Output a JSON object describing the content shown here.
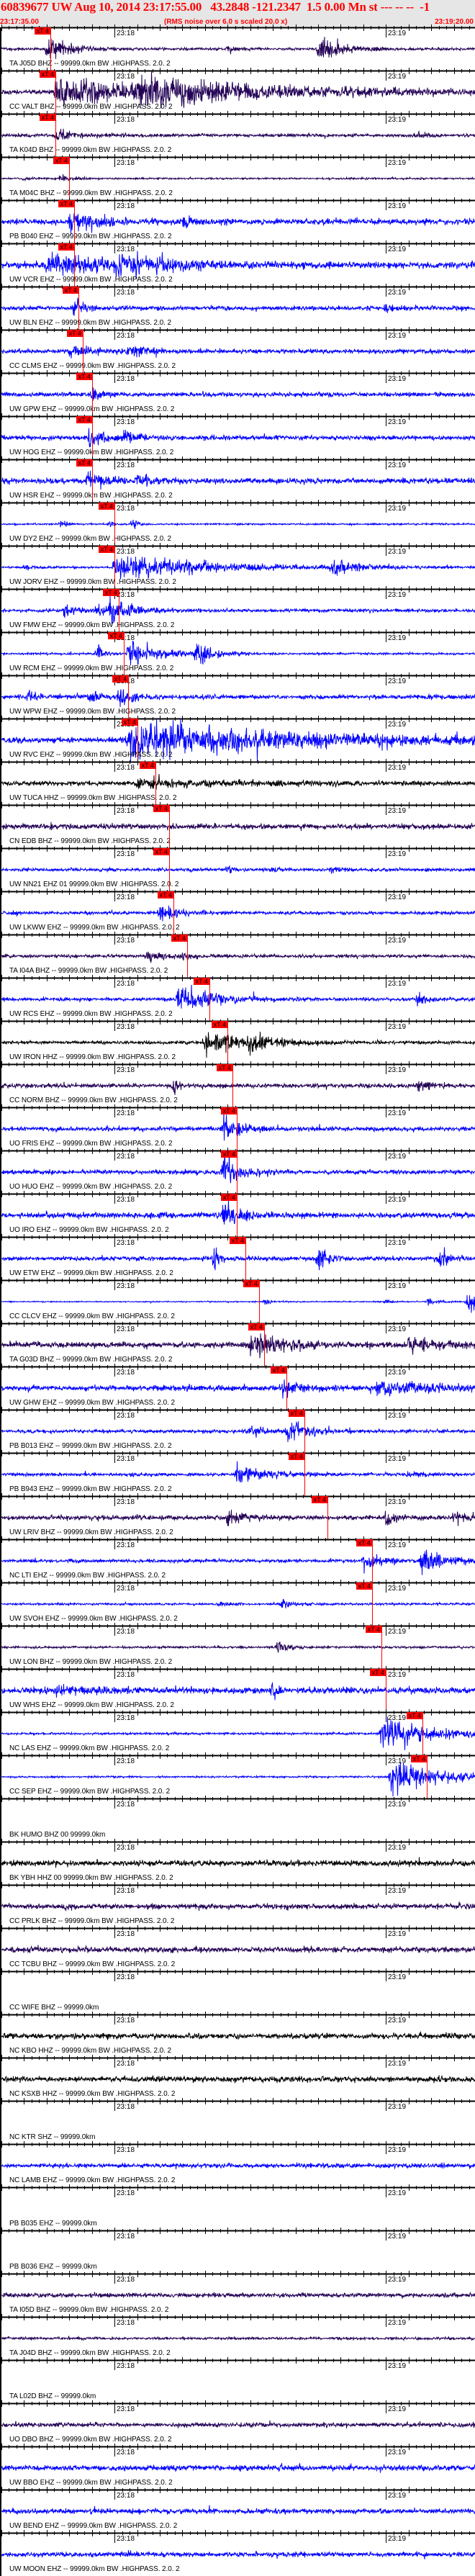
{
  "header": {
    "title": "60839677 UW Aug 10, 2014 23:17:55.00   43.2848 -121.2347  1.5 0.00 Mn st --- -- --  -1",
    "start_time": "23:17:35.00",
    "note": "(RMS noise over 6.0 s scaled 20.0 x)",
    "end_time": "23:19:20.00"
  },
  "colors": {
    "navy": "#220055",
    "blue": "#0000ff",
    "black": "#000000",
    "pick": "#ff0000",
    "header_text": "#ff0000"
  },
  "chart_data": {
    "type": "line",
    "title": "60839677 UW Aug 10, 2014 23:17:55.00",
    "x_range_seconds": [
      0,
      105
    ],
    "x_origin": "23:17:35.00",
    "tick_labels": [
      {
        "t": 25,
        "label": "23:18"
      },
      {
        "t": 85,
        "label": "23:19"
      }
    ],
    "pick_label": "xT 4",
    "traces": [
      {
        "label": "TA J05D BHZ -- 99999.0km BW .HIGHPASS. 2.0. 2",
        "color": "navy",
        "noise": 0.12,
        "pick": 10.8,
        "events": [
          [
            10,
            1.2,
            4
          ],
          [
            70,
            1.0,
            5
          ],
          [
            50,
            0.3,
            2
          ]
        ]
      },
      {
        "label": "CC VALT BHZ -- 99999.0km BW .HIGHPASS. 2.0. 2",
        "color": "navy",
        "noise": 0.2,
        "pick": 11.9,
        "events": [
          [
            12,
            0.9,
            30
          ],
          [
            30,
            0.8,
            25
          ]
        ]
      },
      {
        "label": "TA K04D BHZ -- 99999.0km BW .HIGHPASS. 2.0. 2",
        "color": "navy",
        "noise": 0.15,
        "pick": 11.9,
        "events": [
          [
            12,
            0.4,
            5
          ],
          [
            92,
            0.35,
            2
          ]
        ]
      },
      {
        "label": "TA M04C BHZ -- 99999.0km BW .HIGHPASS. 2.0. 2",
        "color": "navy",
        "noise": 0.08,
        "pick": 15.0,
        "events": [
          [
            13,
            0.35,
            2
          ],
          [
            5,
            0.2,
            1
          ]
        ]
      },
      {
        "label": "PB B040 EHZ -- 99999.0km BW .HIGHPASS. 2.0. 2",
        "color": "blue",
        "noise": 0.25,
        "pick": 16.1,
        "events": [
          [
            15,
            0.8,
            6
          ],
          [
            40,
            0.35,
            4
          ]
        ]
      },
      {
        "label": "UW VCR EHZ -- 99999.0km BW .HIGHPASS. 2.0. 2",
        "color": "blue",
        "noise": 0.3,
        "pick": 16.1,
        "events": [
          [
            10,
            0.7,
            15
          ],
          [
            25,
            0.5,
            10
          ]
        ]
      },
      {
        "label": "UW BLN EHZ -- 99999.0km BW .HIGHPASS. 2.0. 2",
        "color": "blue",
        "noise": 0.2,
        "pick": 17.0,
        "events": [
          [
            16,
            0.8,
            2
          ],
          [
            85,
            0.6,
            1
          ]
        ]
      },
      {
        "label": "CC CLMS EHZ -- 99999.0km BW .HIGHPASS. 2.0. 2",
        "color": "blue",
        "noise": 0.2,
        "pick": 18.0,
        "events": [
          [
            15,
            0.4,
            5
          ],
          [
            28,
            0.4,
            4
          ]
        ]
      },
      {
        "label": "UW GPW EHZ -- 99999.0km BW .HIGHPASS. 2.0. 2",
        "color": "blue",
        "noise": 0.2,
        "pick": 20.0,
        "events": [
          [
            20,
            0.7,
            2
          ]
        ]
      },
      {
        "label": "UW HOG EHZ -- 99999.0km BW .HIGHPASS. 2.0. 2",
        "color": "blue",
        "noise": 0.2,
        "pick": 20.0,
        "events": [
          [
            19,
            0.6,
            4
          ],
          [
            27,
            0.4,
            3
          ]
        ]
      },
      {
        "label": "UW HSR EHZ -- 99999.0km BW .HIGHPASS. 2.0. 2",
        "color": "blue",
        "noise": 0.25,
        "pick": 20.0,
        "events": [
          [
            19,
            0.6,
            4
          ],
          [
            30,
            0.4,
            3
          ]
        ]
      },
      {
        "label": "UW DY2 EHZ -- 99999.0km BW .HIGHPASS. 2.0. 2",
        "color": "blue",
        "noise": 0.08,
        "pick": 25.0,
        "events": [
          [
            13,
            0.5,
            1
          ],
          [
            29,
            0.5,
            1
          ],
          [
            24,
            0.3,
            1
          ]
        ]
      },
      {
        "label": "UW JORV EHZ -- 99999.0km BW .HIGHPASS. 2.0. 2",
        "color": "blue",
        "noise": 0.08,
        "pick": 25.0,
        "events": [
          [
            25,
            1.0,
            20
          ],
          [
            5,
            0.2,
            3
          ],
          [
            73,
            0.5,
            6
          ]
        ]
      },
      {
        "label": "UW FMW EHZ -- 99999.0km BW .HIGHPASS. 2.0. 2",
        "color": "blue",
        "noise": 0.15,
        "pick": 26.0,
        "events": [
          [
            14,
            0.6,
            2
          ],
          [
            21,
            0.5,
            2
          ],
          [
            24,
            1.0,
            4
          ]
        ]
      },
      {
        "label": "UW RCM EHZ -- 99999.0km BW .HIGHPASS. 2.0. 2",
        "color": "blue",
        "noise": 0.1,
        "pick": 27.0,
        "events": [
          [
            21,
            1.0,
            1
          ],
          [
            28,
            1.0,
            6
          ],
          [
            43,
            1.0,
            3
          ]
        ]
      },
      {
        "label": "UW WPW EHZ -- 99999.0km BW .HIGHPASS. 2.0. 2",
        "color": "blue",
        "noise": 0.2,
        "pick": 28.0,
        "events": [
          [
            6,
            0.4,
            2
          ],
          [
            19,
            0.4,
            3
          ],
          [
            26,
            0.6,
            3
          ]
        ]
      },
      {
        "label": "UW RVC EHZ -- 99999.0km BW .HIGHPASS. 2.0. 2",
        "color": "blue",
        "noise": 0.25,
        "pick": 30.0,
        "events": [
          [
            28,
            1.2,
            40
          ]
        ]
      },
      {
        "label": "UW TUCA HHZ -- 99999.0km BW .HIGHPASS. 2.0. 2",
        "color": "black",
        "noise": 0.2,
        "pick": 34.0,
        "events": [
          [
            30,
            0.3,
            20
          ]
        ]
      },
      {
        "label": "CN EDB BHZ -- 99999.0km BW .HIGHPASS. 2.0. 2",
        "color": "navy",
        "noise": 0.25,
        "pick": 37.0,
        "events": []
      },
      {
        "label": "UW NN21 EHZ 01 99999.0km BW .HIGHPASS. 2.0. 2",
        "color": "blue",
        "noise": 0.15,
        "pick": 37.0,
        "events": [
          [
            50,
            0.3,
            1
          ],
          [
            60,
            0.3,
            1
          ],
          [
            73,
            0.3,
            2
          ]
        ]
      },
      {
        "label": "UW LKWW EHZ -- 99999.0km BW .HIGHPASS. 2.0. 2",
        "color": "blue",
        "noise": 0.15,
        "pick": 38.0,
        "events": [
          [
            35,
            0.8,
            3
          ]
        ]
      },
      {
        "label": "TA I04A BHZ -- 99999.0km BW .HIGHPASS. 2.0. 2",
        "color": "navy",
        "noise": 0.15,
        "pick": 41.0,
        "events": [
          [
            32,
            0.6,
            3
          ],
          [
            40,
            0.4,
            2
          ]
        ]
      },
      {
        "label": "UW RCS EHZ -- 99999.0km BW .HIGHPASS. 2.0. 2",
        "color": "blue",
        "noise": 0.15,
        "pick": 46.0,
        "events": [
          [
            39,
            1.0,
            8
          ],
          [
            92,
            0.5,
            2
          ]
        ]
      },
      {
        "label": "UW IRON HHZ -- 99999.0km BW .HIGHPASS. 2.0. 2",
        "color": "black",
        "noise": 0.15,
        "pick": 50.0,
        "events": [
          [
            45,
            0.9,
            8
          ],
          [
            55,
            0.6,
            5
          ]
        ]
      },
      {
        "label": "CC NORM BHZ -- 99999.0km BW .HIGHPASS. 2.0. 2",
        "color": "navy",
        "noise": 0.2,
        "pick": 51.0,
        "events": [
          [
            38,
            0.8,
            1
          ],
          [
            92,
            0.4,
            2
          ]
        ]
      },
      {
        "label": "UO FRIS EHZ -- 99999.0km BW .HIGHPASS. 2.0. 2",
        "color": "blue",
        "noise": 0.2,
        "pick": 52.0,
        "events": [
          [
            49,
            1.2,
            3
          ]
        ]
      },
      {
        "label": "UO HUO EHZ -- 99999.0km BW .HIGHPASS. 2.0. 2",
        "color": "blue",
        "noise": 0.2,
        "pick": 52.0,
        "events": [
          [
            49,
            1.2,
            3
          ]
        ]
      },
      {
        "label": "UO IRO EHZ -- 99999.0km BW .HIGHPASS. 2.0. 2",
        "color": "blue",
        "noise": 0.25,
        "pick": 52.0,
        "events": [
          [
            49,
            1.2,
            3
          ]
        ]
      },
      {
        "label": "UW ETW EHZ -- 99999.0km BW .HIGHPASS. 2.0. 2",
        "color": "blue",
        "noise": 0.2,
        "pick": 54.0,
        "events": [
          [
            47,
            1.0,
            1
          ],
          [
            70,
            1.2,
            2
          ],
          [
            97,
            1.2,
            1
          ]
        ]
      },
      {
        "label": "CC CLCV EHZ -- 99999.0km BW .HIGHPASS. 2.0. 2",
        "color": "blue",
        "noise": 0.05,
        "pick": 57.0,
        "events": [
          [
            58,
            0.2,
            2
          ],
          [
            85,
            0.2,
            1
          ],
          [
            94,
            0.3,
            2
          ],
          [
            103,
            1.0,
            3
          ]
        ]
      },
      {
        "label": "TA G03D BHZ -- 99999.0km BW .HIGHPASS. 2.0. 2",
        "color": "navy",
        "noise": 0.25,
        "pick": 58.0,
        "events": [
          [
            55,
            0.9,
            8
          ],
          [
            90,
            0.4,
            10
          ]
        ]
      },
      {
        "label": "UW GHW EHZ -- 99999.0km BW .HIGHPASS. 2.0. 2",
        "color": "blue",
        "noise": 0.25,
        "pick": 63.0,
        "events": [
          [
            62,
            0.5,
            4
          ],
          [
            83,
            0.6,
            10
          ]
        ]
      },
      {
        "label": "PB B013 EHZ -- 99999.0km BW .HIGHPASS. 2.0. 2",
        "color": "blue",
        "noise": 0.15,
        "pick": 67.0,
        "events": [
          [
            55,
            0.4,
            3
          ],
          [
            63,
            0.9,
            4
          ]
        ]
      },
      {
        "label": "PB B943 EHZ -- 99999.0km BW .HIGHPASS. 2.0. 2",
        "color": "blue",
        "noise": 0.15,
        "pick": 67.0,
        "events": [
          [
            52,
            0.7,
            6
          ],
          [
            90,
            0.2,
            3
          ]
        ]
      },
      {
        "label": "UW LRIV BHZ -- 99999.0km BW .HIGHPASS. 2.0. 2",
        "color": "navy",
        "noise": 0.2,
        "pick": 72.0,
        "events": [
          [
            50,
            0.6,
            3
          ],
          [
            85,
            0.7,
            2
          ],
          [
            100,
            0.7,
            2
          ]
        ]
      },
      {
        "label": "NC LTI EHZ -- 99999.0km BW .HIGHPASS. 2.0. 2",
        "color": "blue",
        "noise": 0.15,
        "pick": 82.0,
        "events": [
          [
            80,
            0.5,
            5
          ],
          [
            93,
            0.9,
            5
          ]
        ]
      },
      {
        "label": "UW SVOH EHZ -- 99999.0km BW .HIGHPASS. 2.0. 2",
        "color": "blue",
        "noise": 0.1,
        "pick": 82.0,
        "events": [
          [
            48,
            0.2,
            2
          ],
          [
            62,
            0.4,
            2
          ]
        ]
      },
      {
        "label": "UW LON BHZ -- 99999.0km BW .HIGHPASS. 2.0. 2",
        "color": "navy",
        "noise": 0.1,
        "pick": 84.0,
        "events": [
          [
            61,
            0.6,
            2
          ]
        ]
      },
      {
        "label": "UW WHS EHZ -- 99999.0km BW .HIGHPASS. 2.0. 2",
        "color": "blue",
        "noise": 0.3,
        "pick": 85.0,
        "events": [
          [
            12,
            0.3,
            6
          ],
          [
            60,
            0.7,
            1
          ]
        ]
      },
      {
        "label": "NC LAS EHZ -- 99999.0km BW .HIGHPASS. 2.0. 2",
        "color": "blue",
        "noise": 0.1,
        "pick": 93.0,
        "events": [
          [
            84,
            1.2,
            10
          ]
        ]
      },
      {
        "label": "CC SEP EHZ -- 99999.0km BW .HIGHPASS. 2.0. 2",
        "color": "blue",
        "noise": 0.08,
        "pick": 94.0,
        "events": [
          [
            86,
            1.3,
            10
          ]
        ]
      },
      {
        "label": "BK HUMO BHZ 00 99999.0km",
        "color": "navy",
        "noise": 0,
        "pick": null,
        "events": []
      },
      {
        "label": "BK YBH HHZ 00 99999.0km BW .HIGHPASS. 2.0. 2",
        "color": "black",
        "noise": 0.25,
        "pick": null,
        "events": []
      },
      {
        "label": "CC PRLK BHZ -- 99999.0km BW .HIGHPASS. 2.0. 2",
        "color": "navy",
        "noise": 0.25,
        "pick": null,
        "events": []
      },
      {
        "label": "CC TCBU BHZ -- 99999.0km BW .HIGHPASS. 2.0. 2",
        "color": "navy",
        "noise": 0.25,
        "pick": null,
        "events": []
      },
      {
        "label": "CC WIFE BHZ -- 99999.0km",
        "color": "black",
        "noise": 0,
        "pick": null,
        "events": []
      },
      {
        "label": "NC KBO HHZ -- 99999.0km BW .HIGHPASS. 2.0. 2",
        "color": "black",
        "noise": 0.25,
        "pick": null,
        "events": []
      },
      {
        "label": "NC KSXB HHZ -- 99999.0km BW .HIGHPASS. 2.0. 2",
        "color": "black",
        "noise": 0.25,
        "pick": null,
        "events": []
      },
      {
        "label": "NC KTR SHZ -- 99999.0km",
        "color": "blue",
        "noise": 0,
        "pick": null,
        "events": []
      },
      {
        "label": "NC LAMB EHZ -- 99999.0km BW .HIGHPASS. 2.0. 2",
        "color": "blue",
        "noise": 0.2,
        "pick": null,
        "events": []
      },
      {
        "label": "PB B035 EHZ -- 99999.0km",
        "color": "blue",
        "noise": 0,
        "pick": null,
        "events": []
      },
      {
        "label": "PB B036 EHZ -- 99999.0km",
        "color": "blue",
        "noise": 0,
        "pick": null,
        "events": []
      },
      {
        "label": "TA I05D BHZ -- 99999.0km BW .HIGHPASS. 2.0. 2",
        "color": "navy",
        "noise": 0.2,
        "pick": null,
        "events": []
      },
      {
        "label": "TA J04D BHZ -- 99999.0km BW .HIGHPASS. 2.0. 2",
        "color": "navy",
        "noise": 0.12,
        "pick": null,
        "events": []
      },
      {
        "label": "TA L02D BHZ -- 99999.0km",
        "color": "navy",
        "noise": 0,
        "pick": null,
        "events": []
      },
      {
        "label": "UO DBO BHZ -- 99999.0km BW .HIGHPASS. 2.0. 2",
        "color": "navy",
        "noise": 0.2,
        "pick": null,
        "events": []
      },
      {
        "label": "UW BBO EHZ -- 99999.0km BW .HIGHPASS. 2.0. 2",
        "color": "blue",
        "noise": 0.25,
        "pick": null,
        "events": []
      },
      {
        "label": "UW BEND EHZ -- 99999.0km BW .HIGHPASS. 2.0. 2",
        "color": "blue",
        "noise": 0.22,
        "pick": null,
        "events": []
      },
      {
        "label": "UW MOON EHZ -- 99999.0km BW .HIGHPASS. 2.0. 2",
        "color": "blue",
        "noise": 0.22,
        "pick": null,
        "events": []
      }
    ]
  }
}
